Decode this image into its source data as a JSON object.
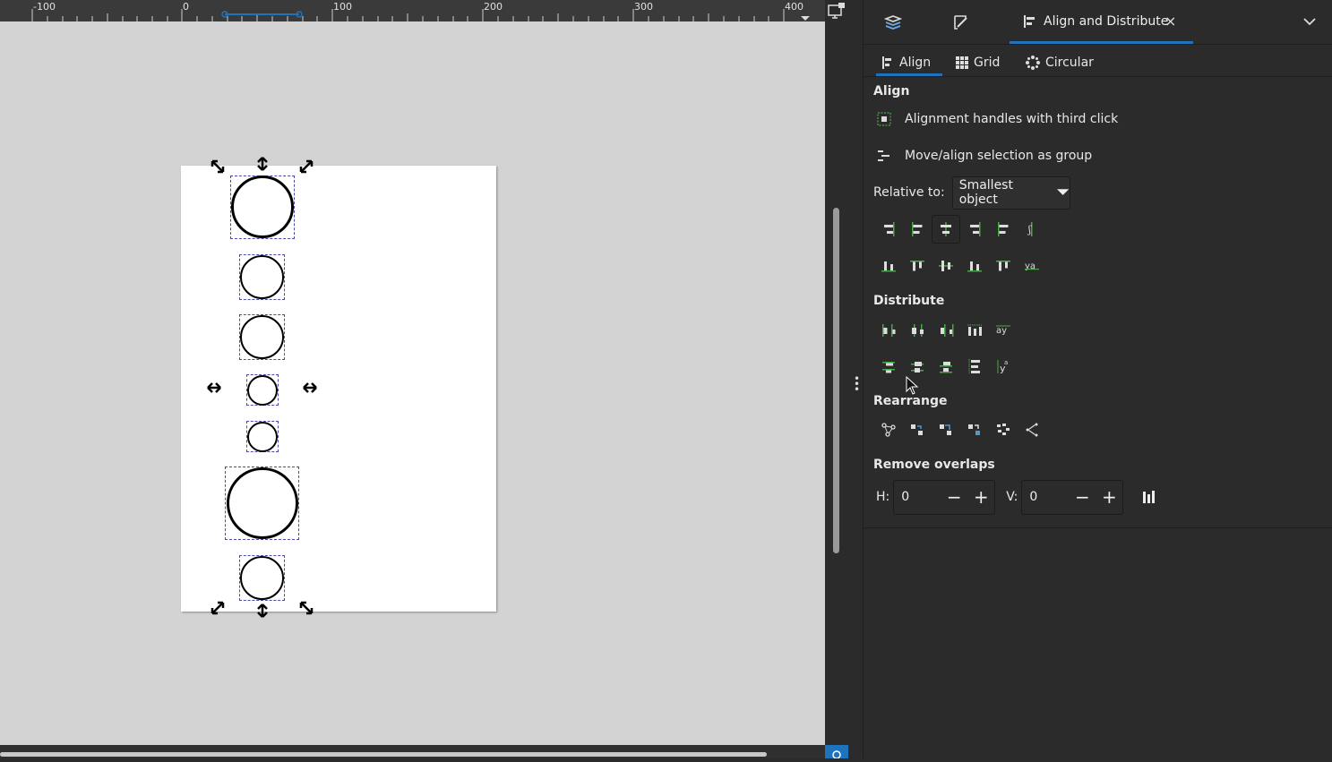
{
  "ruler": {
    "labels": [
      "-100",
      "0",
      "100",
      "200",
      "300",
      "400"
    ]
  },
  "dock": {
    "tabs": [
      {
        "icon": "layers-icon"
      },
      {
        "icon": "fill-stroke-icon"
      }
    ],
    "active_tab": {
      "icon": "align-distribute-icon",
      "title": "Align and Distribute",
      "close": "×"
    },
    "menu_icon": "chevron-down-icon"
  },
  "subtabs": [
    {
      "label": "Align",
      "icon": "align-icon",
      "active": true
    },
    {
      "label": "Grid",
      "icon": "grid-icon",
      "active": false
    },
    {
      "label": "Circular",
      "icon": "circular-icon",
      "active": false
    }
  ],
  "align": {
    "section_title": "Align",
    "option_handles": "Alignment handles with third click",
    "option_group": "Move/align selection as group",
    "relative_label": "Relative to:",
    "relative_value": "Smallest object"
  },
  "distribute": {
    "section_title": "Distribute"
  },
  "rearrange": {
    "section_title": "Rearrange"
  },
  "remove_overlaps": {
    "section_title": "Remove overlaps",
    "h_label": "H:",
    "h_value": "0",
    "v_label": "V:",
    "v_value": "0",
    "minus": "−",
    "plus": "+"
  },
  "colors": {
    "accent": "#1e73be",
    "panel_bg": "#2b2b2b",
    "canvas_bg": "#d3d3d3",
    "selection_dash": "#4a4aa8"
  }
}
